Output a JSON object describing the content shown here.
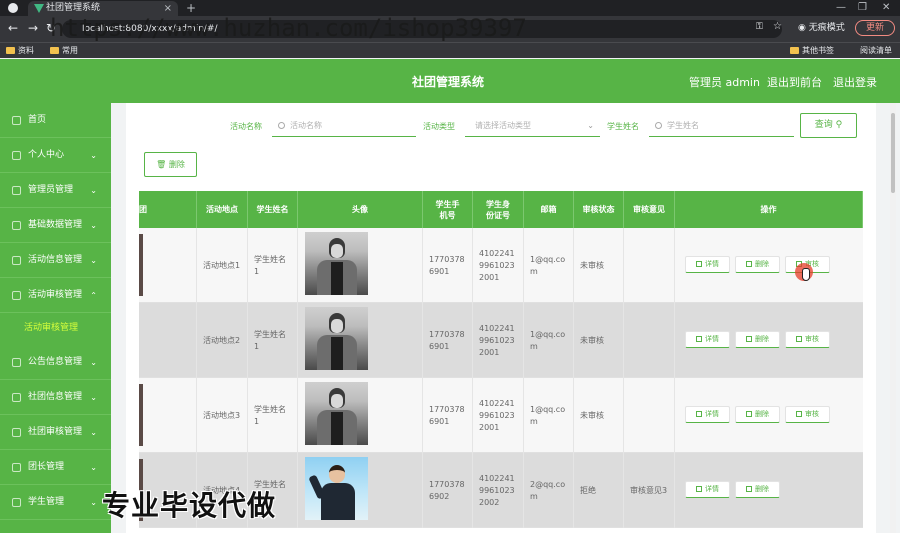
{
  "browser": {
    "tab_title": "社团管理系统",
    "url": "localhost:8080/xxxx/admin/#/",
    "incognito_label": "无痕模式",
    "update_label": "更新",
    "bookmarks": [
      "资料",
      "常用"
    ],
    "bookmarks_right": [
      "其他书签",
      "阅读清单"
    ],
    "new_tab": "+",
    "close_tab": "×"
  },
  "watermark_url": "https://www.huzhan.com/ishop39397",
  "header": {
    "title": "社团管理系统",
    "admin": "管理员 admin",
    "back_front": "退出到前台",
    "logout": "退出登录"
  },
  "sidebar": {
    "items": [
      {
        "label": "首页",
        "chevron": ""
      },
      {
        "label": "个人中心",
        "chevron": "⌄"
      },
      {
        "label": "管理员管理",
        "chevron": "⌄"
      },
      {
        "label": "基础数据管理",
        "chevron": "⌄"
      },
      {
        "label": "活动信息管理",
        "chevron": "⌄"
      },
      {
        "label": "活动审核管理",
        "chevron": "⌃"
      },
      {
        "label": "公告信息管理",
        "chevron": "⌄"
      },
      {
        "label": "社团信息管理",
        "chevron": "⌄"
      },
      {
        "label": "社团审核管理",
        "chevron": "⌄"
      },
      {
        "label": "团长管理",
        "chevron": "⌄"
      },
      {
        "label": "学生管理",
        "chevron": "⌄"
      }
    ],
    "sub_item": "活动审核管理"
  },
  "filters": {
    "activity_name_label": "活动名称",
    "activity_name_placeholder": "活动名称",
    "activity_type_label": "活动类型",
    "activity_type_placeholder": "请选择活动类型",
    "student_name_label": "学生姓名",
    "student_name_placeholder": "学生姓名",
    "query_button": "查询",
    "delete_button": "删除"
  },
  "table": {
    "headers": [
      "团",
      "活动地点",
      "学生姓名",
      "头像",
      "学生手机号",
      "学生身份证号",
      "邮箱",
      "审核状态",
      "审核意见",
      "操作"
    ],
    "rows": [
      {
        "place": "活动地点1",
        "name": "学生姓名1",
        "phone": "17703786901",
        "idcard": "410224199610232001",
        "email": "1@qq.com",
        "status": "未审核",
        "opinion": "",
        "photo": "bw",
        "actions": [
          "详情",
          "删除",
          "审核"
        ]
      },
      {
        "place": "活动地点2",
        "name": "学生姓名1",
        "phone": "17703786901",
        "idcard": "410224199610232001",
        "email": "1@qq.com",
        "status": "未审核",
        "opinion": "",
        "photo": "bw",
        "actions": [
          "详情",
          "删除",
          "审核"
        ]
      },
      {
        "place": "活动地点3",
        "name": "学生姓名1",
        "phone": "17703786901",
        "idcard": "410224199610232001",
        "email": "1@qq.com",
        "status": "未审核",
        "opinion": "",
        "photo": "bw",
        "actions": [
          "详情",
          "删除",
          "审核"
        ]
      },
      {
        "place": "活动地点4",
        "name": "学生姓名2",
        "phone": "17703786902",
        "idcard": "410224199610232002",
        "email": "2@qq.com",
        "status": "拒绝",
        "opinion": "审核意见3",
        "photo": "color",
        "actions": [
          "详情",
          "删除"
        ]
      }
    ]
  },
  "footer_watermark": "专业毕设代做",
  "colors": {
    "primary": "#57b446",
    "sub_active": "#d6ff3b"
  }
}
